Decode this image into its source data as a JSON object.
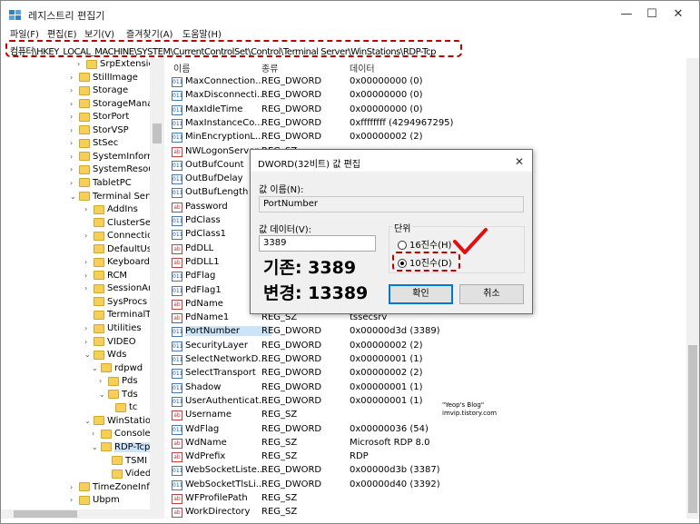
{
  "window": {
    "title": "레지스트리 편집기",
    "controls": {
      "minimize": "—",
      "maximize": "☐",
      "close": "✕"
    }
  },
  "menu": [
    "파일(F)",
    "편집(E)",
    "보기(V)",
    "즐겨찾기(A)",
    "도움말(H)"
  ],
  "address": "컴퓨터\\HKEY_LOCAL_MACHINE\\SYSTEM\\CurrentControlSet\\Control\\Terminal Server\\WinStations\\RDP-Tcp",
  "tree": [
    {
      "label": "SrpExtensionC",
      "exp": "›"
    },
    {
      "label": "StillImage",
      "exp": "›"
    },
    {
      "label": "Storage",
      "exp": "›"
    },
    {
      "label": "StorageManag",
      "exp": "›"
    },
    {
      "label": "StorPort",
      "exp": "›"
    },
    {
      "label": "StorVSP",
      "exp": "›"
    },
    {
      "label": "StSec",
      "exp": "›"
    },
    {
      "label": "SystemInform",
      "exp": "›"
    },
    {
      "label": "SystemResour",
      "exp": "›"
    },
    {
      "label": "TabletPC",
      "exp": "›"
    },
    {
      "label": "Terminal Serv",
      "exp": "⌄"
    },
    {
      "label": "AddIns",
      "exp": "›"
    },
    {
      "label": "ClusterSett",
      "exp": ""
    },
    {
      "label": "Connection",
      "exp": "›"
    },
    {
      "label": "DefaultUse",
      "exp": ""
    },
    {
      "label": "KeyboardTy",
      "exp": "›"
    },
    {
      "label": "RCM",
      "exp": "›"
    },
    {
      "label": "SessionArb",
      "exp": "›"
    },
    {
      "label": "SysProcs",
      "exp": ""
    },
    {
      "label": "TerminalTy",
      "exp": ""
    },
    {
      "label": "Utilities",
      "exp": "›"
    },
    {
      "label": "VIDEO",
      "exp": "›"
    },
    {
      "label": "Wds",
      "exp": "⌄"
    },
    {
      "label": "rdpwd",
      "exp": "⌄"
    },
    {
      "label": "Pds",
      "exp": "›"
    },
    {
      "label": "Tds",
      "exp": "⌄"
    },
    {
      "label": "tc",
      "exp": ""
    },
    {
      "label": "WinStation",
      "exp": "⌄"
    },
    {
      "label": "Console",
      "exp": "›"
    },
    {
      "label": "RDP-Tcp",
      "exp": "⌄"
    },
    {
      "label": "TSMI",
      "exp": ""
    },
    {
      "label": "Vided",
      "exp": ""
    },
    {
      "label": "TimeZoneInfo",
      "exp": "›"
    },
    {
      "label": "Ubpm",
      "exp": "›"
    }
  ],
  "list": {
    "headers": {
      "name": "이름",
      "type": "종류",
      "data": "데이터"
    },
    "rows": [
      {
        "name": "MaxConnection...",
        "type": "REG_DWORD",
        "data": "0x00000000 (0)",
        "icon": "011"
      },
      {
        "name": "MaxDisconnecti...",
        "type": "REG_DWORD",
        "data": "0x00000000 (0)",
        "icon": "011"
      },
      {
        "name": "MaxIdleTime",
        "type": "REG_DWORD",
        "data": "0x00000000 (0)",
        "icon": "011"
      },
      {
        "name": "MaxInstanceCo...",
        "type": "REG_DWORD",
        "data": "0xffffffff (4294967295)",
        "icon": "011"
      },
      {
        "name": "MinEncryptionL...",
        "type": "REG_DWORD",
        "data": "0x00000002 (2)",
        "icon": "011"
      },
      {
        "name": "NWLogonServer",
        "type": "REG_SZ",
        "data": "",
        "icon": "ab"
      },
      {
        "name": "OutBufCount",
        "type": "",
        "data": "",
        "icon": "011"
      },
      {
        "name": "OutBufDelay",
        "type": "",
        "data": "",
        "icon": "011"
      },
      {
        "name": "OutBufLength",
        "type": "",
        "data": "",
        "icon": "011"
      },
      {
        "name": "Password",
        "type": "",
        "data": "",
        "icon": "ab"
      },
      {
        "name": "PdClass",
        "type": "",
        "data": "",
        "icon": "011"
      },
      {
        "name": "PdClass1",
        "type": "",
        "data": "",
        "icon": "011"
      },
      {
        "name": "PdDLL",
        "type": "",
        "data": "",
        "icon": "ab"
      },
      {
        "name": "PdDLL1",
        "type": "",
        "data": "",
        "icon": "ab"
      },
      {
        "name": "PdFlag",
        "type": "",
        "data": "",
        "icon": "011"
      },
      {
        "name": "PdFlag1",
        "type": "",
        "data": "",
        "icon": "011"
      },
      {
        "name": "PdName",
        "type": "",
        "data": "",
        "icon": "ab"
      },
      {
        "name": "PdName1",
        "type": "REG_SZ",
        "data": "tssecsrv",
        "icon": "ab"
      },
      {
        "name": "PortNumber",
        "type": "REG_DWORD",
        "data": "0x00000d3d (3389)",
        "icon": "011",
        "selected": true
      },
      {
        "name": "SecurityLayer",
        "type": "REG_DWORD",
        "data": "0x00000002 (2)",
        "icon": "011"
      },
      {
        "name": "SelectNetworkD...",
        "type": "REG_DWORD",
        "data": "0x00000001 (1)",
        "icon": "011"
      },
      {
        "name": "SelectTransport",
        "type": "REG_DWORD",
        "data": "0x00000002 (2)",
        "icon": "011"
      },
      {
        "name": "Shadow",
        "type": "REG_DWORD",
        "data": "0x00000001 (1)",
        "icon": "011"
      },
      {
        "name": "UserAuthenticat...",
        "type": "REG_DWORD",
        "data": "0x00000001 (1)",
        "icon": "011"
      },
      {
        "name": "Username",
        "type": "REG_SZ",
        "data": "",
        "icon": "ab"
      },
      {
        "name": "WdFlag",
        "type": "REG_DWORD",
        "data": "0x00000036 (54)",
        "icon": "011"
      },
      {
        "name": "WdName",
        "type": "REG_SZ",
        "data": "Microsoft RDP 8.0",
        "icon": "ab"
      },
      {
        "name": "WdPrefix",
        "type": "REG_SZ",
        "data": "RDP",
        "icon": "ab"
      },
      {
        "name": "WebSocketListe...",
        "type": "REG_DWORD",
        "data": "0x00000d3b (3387)",
        "icon": "011"
      },
      {
        "name": "WebSocketTlsLi...",
        "type": "REG_DWORD",
        "data": "0x00000d40 (3392)",
        "icon": "011"
      },
      {
        "name": "WFProfilePath",
        "type": "REG_SZ",
        "data": "",
        "icon": "ab"
      },
      {
        "name": "WorkDirectory",
        "type": "REG_SZ",
        "data": "",
        "icon": "ab"
      }
    ]
  },
  "watermark": {
    "line1": "\"Yeop's Blog\"",
    "line2": "imvip.tistory.com"
  },
  "dialog": {
    "title": "DWORD(32비트) 값 편집",
    "close": "✕",
    "name_label": "값 이름(N):",
    "name_value": "PortNumber",
    "data_label": "값 데이터(V):",
    "data_value": "3389",
    "base_label": "단위",
    "hex_label": "16진수(H)",
    "dec_label": "10진수(D)",
    "ok": "확인",
    "cancel": "취소"
  },
  "annotation": {
    "before": "기존: 3389",
    "after": "변경: 13389"
  }
}
